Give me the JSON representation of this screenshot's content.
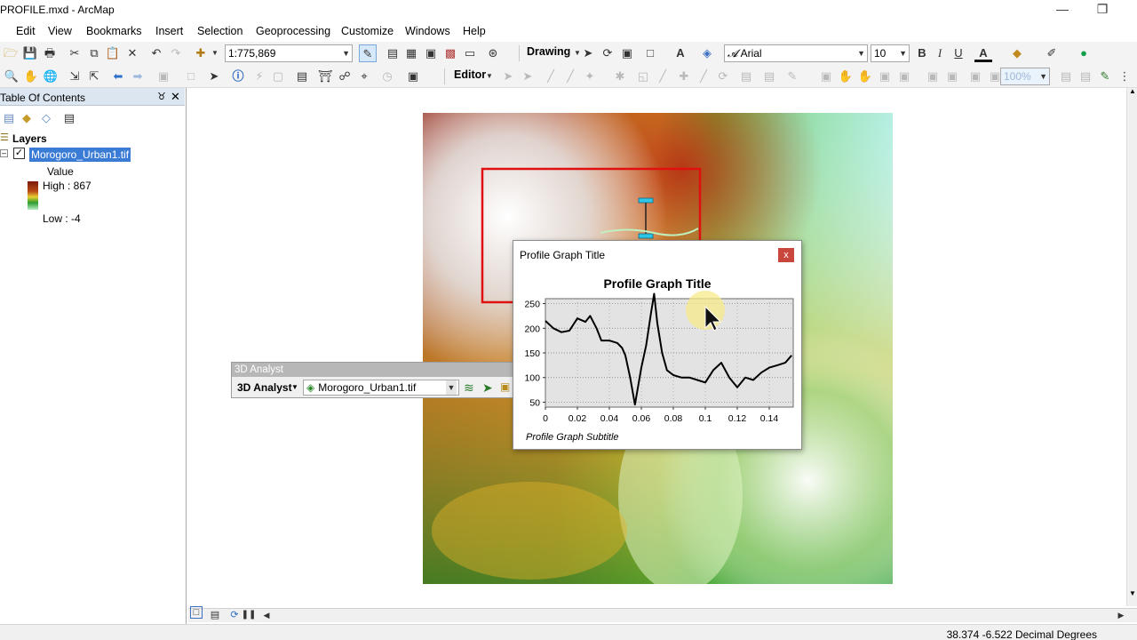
{
  "window": {
    "title": "PROFILE.mxd - ArcMap",
    "minimize_icon": "minimize-icon",
    "restore_icon": "restore-icon"
  },
  "menu": [
    "Edit",
    "View",
    "Bookmarks",
    "Insert",
    "Selection",
    "Geoprocessing",
    "Customize",
    "Windows",
    "Help"
  ],
  "toolbar": {
    "scale": "1:775,869",
    "drawing_label": "Drawing",
    "font_name": "Arial",
    "font_size": "10",
    "bold": "B",
    "italic": "I",
    "underline": "U",
    "text_color_glyph": "A",
    "editor_label": "Editor",
    "zoom_value": "100%"
  },
  "toc": {
    "title": "Table Of Contents",
    "layers_label": "Layers",
    "layer_name": "Morogoro_Urban1.tif",
    "legend_heading": "Value",
    "high_label": "High : 867",
    "low_label": "Low : -4"
  },
  "analyst": {
    "title": "3D Analyst",
    "menu_label": "3D Analyst",
    "layer_combo": "Morogoro_Urban1.tif"
  },
  "profile": {
    "window_title": "Profile Graph Title",
    "close_label": "x",
    "subtitle": "Profile Graph Subtitle"
  },
  "chart_data": {
    "type": "line",
    "title": "Profile Graph Title",
    "subtitle": "Profile Graph Subtitle",
    "xlabel": "",
    "ylabel": "",
    "xlim": [
      0,
      0.155
    ],
    "ylim": [
      40,
      260
    ],
    "xticks": [
      "0",
      "0.02",
      "0.04",
      "0.06",
      "0.08",
      "0.1",
      "0.12",
      "0.14"
    ],
    "yticks": [
      "50",
      "100",
      "150",
      "200",
      "250"
    ],
    "grid": true,
    "series": [
      {
        "x": [
          0,
          0.005,
          0.01,
          0.015,
          0.02,
          0.025,
          0.028,
          0.032,
          0.035,
          0.04,
          0.045,
          0.048,
          0.05,
          0.053,
          0.056,
          0.06,
          0.063,
          0.066,
          0.068,
          0.07,
          0.073,
          0.076,
          0.08,
          0.085,
          0.09,
          0.095,
          0.1,
          0.105,
          0.11,
          0.115,
          0.12,
          0.125,
          0.13,
          0.135,
          0.14,
          0.145,
          0.15,
          0.154
        ],
        "y": [
          215,
          200,
          192,
          195,
          220,
          213,
          225,
          200,
          175,
          175,
          170,
          160,
          145,
          100,
          45,
          120,
          165,
          230,
          270,
          210,
          150,
          115,
          105,
          100,
          100,
          95,
          90,
          115,
          130,
          100,
          80,
          100,
          95,
          110,
          120,
          125,
          130,
          145
        ]
      }
    ]
  },
  "status": {
    "coordinates": "38.374  -6.522 Decimal Degrees"
  }
}
